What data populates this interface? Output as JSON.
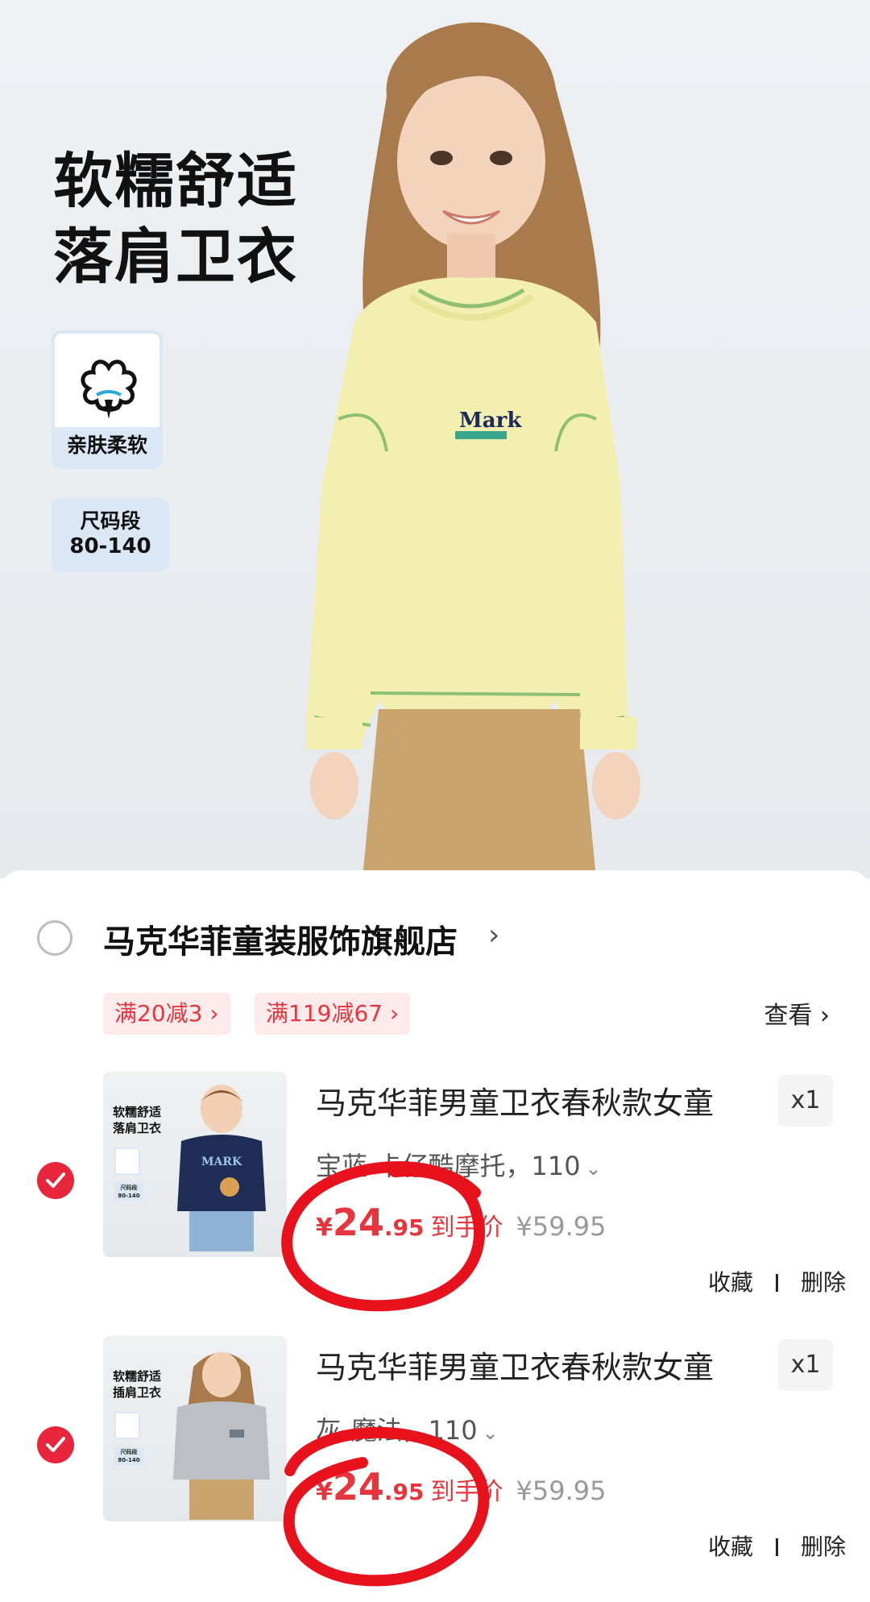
{
  "hero": {
    "title_line1": "软糯舒适",
    "title_line2": "落肩卫衣",
    "badge_cotton_label": "亲肤柔软",
    "badge_size_label": "尺码段",
    "badge_size_range": "80-140",
    "chest_logo_text": "Mark"
  },
  "store": {
    "name": "马克华菲童装服饰旗舰店",
    "arrow": "›",
    "promos": [
      "满20减3 ›",
      "满119减67 ›"
    ],
    "view_label": "查看 ›"
  },
  "items": [
    {
      "thumb_title": "软糯舒适\n落肩卫衣",
      "thumb_size": "尺码段 80-140",
      "thumb_logo": "MARK",
      "title": "马克华菲男童卫衣春秋款女童",
      "qty": "x1",
      "variant": "宝蓝-卡仔酷摩托，110",
      "price_currency": "¥",
      "price_int": "24",
      "price_dec": ".95",
      "price_tag": "到手价",
      "orig_price": "¥59.95",
      "fav_label": "收藏",
      "delete_label": "删除"
    },
    {
      "thumb_title": "软糯舒适\n插肩卫衣",
      "thumb_size": "尺码段 80-140",
      "thumb_logo": "",
      "title": "马克华菲男童卫衣春秋款女童",
      "qty": "x1",
      "variant": "灰-魔法，110",
      "price_currency": "¥",
      "price_int": "24",
      "price_dec": ".95",
      "price_tag": "到手价",
      "orig_price": "¥59.95",
      "fav_label": "收藏",
      "delete_label": "删除"
    }
  ],
  "colors": {
    "accent_red": "#e8343d",
    "check_red": "#e8253a",
    "promo_bg": "#fdebec",
    "badge_blue": "#dbe7f5",
    "sweater_yellow": "#f3efb0"
  }
}
